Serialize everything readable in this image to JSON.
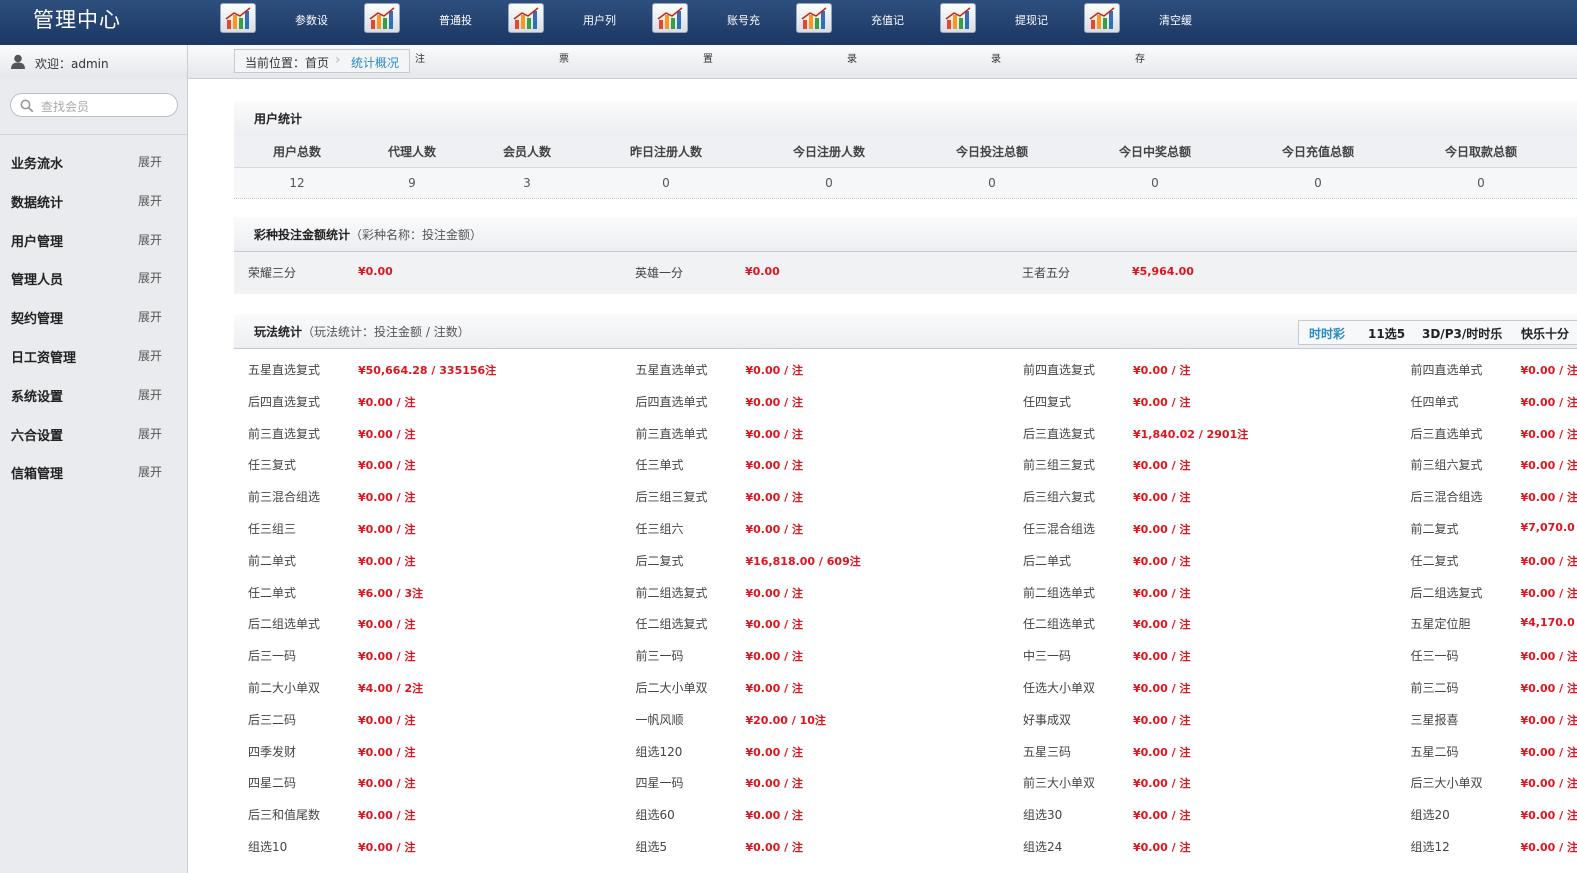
{
  "header": {
    "title": "管理中心",
    "nav": [
      "参数设",
      "普通投",
      "用户列",
      "账号充",
      "充值记",
      "提现记",
      "清空缓"
    ],
    "ghost_marks": [
      "注",
      "票",
      "置",
      "录",
      "录",
      "存"
    ]
  },
  "welcome": {
    "label": "欢迎：admin"
  },
  "breadcrumb": {
    "prefix": "当前位置：首页",
    "current": "统计概况"
  },
  "search": {
    "placeholder": "查找会员"
  },
  "sidebar": {
    "items": [
      {
        "label": "业务流水",
        "toggle": "展开"
      },
      {
        "label": "数据统计",
        "toggle": "展开"
      },
      {
        "label": "用户管理",
        "toggle": "展开"
      },
      {
        "label": "管理人员",
        "toggle": "展开"
      },
      {
        "label": "契约管理",
        "toggle": "展开"
      },
      {
        "label": "日工资管理",
        "toggle": "展开"
      },
      {
        "label": "系统设置",
        "toggle": "展开"
      },
      {
        "label": "六合设置",
        "toggle": "展开"
      },
      {
        "label": "信箱管理",
        "toggle": "展开"
      }
    ]
  },
  "user_stats": {
    "title": "用户统计",
    "headers": [
      "用户总数",
      "代理人数",
      "会员人数",
      "昨日注册人数",
      "今日注册人数",
      "今日投注总额",
      "今日中奖总额",
      "今日充值总额",
      "今日取款总额"
    ],
    "values": [
      "12",
      "9",
      "3",
      "0",
      "0",
      "0",
      "0",
      "0",
      "0"
    ]
  },
  "lottery_stats": {
    "title": "彩种投注金额统计",
    "subtitle": "（彩种名称：投注金额）",
    "items": [
      {
        "name": "荣耀三分",
        "amount": "¥0.00"
      },
      {
        "name": "英雄一分",
        "amount": "¥0.00"
      },
      {
        "name": "王者五分",
        "amount": "¥5,964.00"
      }
    ]
  },
  "play_stats": {
    "title": "玩法统计",
    "subtitle": "（玩法统计：投注金额 / 注数）",
    "tabs": [
      "时时彩",
      "11选5",
      "3D/P3/时时乐",
      "快乐十分"
    ],
    "rows": [
      [
        [
          "五星直选复式",
          "¥50,664.28 / 335156注"
        ],
        [
          "五星直选单式",
          "¥0.00 / 注"
        ],
        [
          "前四直选复式",
          "¥0.00 / 注"
        ],
        [
          "前四直选单式",
          "¥0.00 / 注"
        ]
      ],
      [
        [
          "后四直选复式",
          "¥0.00 / 注"
        ],
        [
          "后四直选单式",
          "¥0.00 / 注"
        ],
        [
          "任四复式",
          "¥0.00 / 注"
        ],
        [
          "任四单式",
          "¥0.00 / 注"
        ]
      ],
      [
        [
          "前三直选复式",
          "¥0.00 / 注"
        ],
        [
          "前三直选单式",
          "¥0.00 / 注"
        ],
        [
          "后三直选复式",
          "¥1,840.02 / 2901注"
        ],
        [
          "后三直选单式",
          "¥0.00 / 注"
        ]
      ],
      [
        [
          "任三复式",
          "¥0.00 / 注"
        ],
        [
          "任三单式",
          "¥0.00 / 注"
        ],
        [
          "前三组三复式",
          "¥0.00 / 注"
        ],
        [
          "前三组六复式",
          "¥0.00 / 注"
        ]
      ],
      [
        [
          "前三混合组选",
          "¥0.00 / 注"
        ],
        [
          "后三组三复式",
          "¥0.00 / 注"
        ],
        [
          "后三组六复式",
          "¥0.00 / 注"
        ],
        [
          "后三混合组选",
          "¥0.00 / 注"
        ]
      ],
      [
        [
          "任三组三",
          "¥0.00 / 注"
        ],
        [
          "任三组六",
          "¥0.00 / 注"
        ],
        [
          "任三混合组选",
          "¥0.00 / 注"
        ],
        [
          "前二复式",
          "¥7,070.0"
        ]
      ],
      [
        [
          "前二单式",
          "¥0.00 / 注"
        ],
        [
          "后二复式",
          "¥16,818.00 / 609注"
        ],
        [
          "后二单式",
          "¥0.00 / 注"
        ],
        [
          "任二复式",
          "¥0.00 / 注"
        ]
      ],
      [
        [
          "任二单式",
          "¥6.00 / 3注"
        ],
        [
          "前二组选复式",
          "¥0.00 / 注"
        ],
        [
          "前二组选单式",
          "¥0.00 / 注"
        ],
        [
          "后二组选复式",
          "¥0.00 / 注"
        ]
      ],
      [
        [
          "后二组选单式",
          "¥0.00 / 注"
        ],
        [
          "任二组选复式",
          "¥0.00 / 注"
        ],
        [
          "任二组选单式",
          "¥0.00 / 注"
        ],
        [
          "五星定位胆",
          "¥4,170.0"
        ]
      ],
      [
        [
          "后三一码",
          "¥0.00 / 注"
        ],
        [
          "前三一码",
          "¥0.00 / 注"
        ],
        [
          "中三一码",
          "¥0.00 / 注"
        ],
        [
          "任三一码",
          "¥0.00 / 注"
        ]
      ],
      [
        [
          "前二大小单双",
          "¥4.00 / 2注"
        ],
        [
          "后二大小单双",
          "¥0.00 / 注"
        ],
        [
          "任选大小单双",
          "¥0.00 / 注"
        ],
        [
          "前三二码",
          "¥0.00 / 注"
        ]
      ],
      [
        [
          "后三二码",
          "¥0.00 / 注"
        ],
        [
          "一帆风顺",
          "¥20.00 / 10注"
        ],
        [
          "好事成双",
          "¥0.00 / 注"
        ],
        [
          "三星报喜",
          "¥0.00 / 注"
        ]
      ],
      [
        [
          "四季发财",
          "¥0.00 / 注"
        ],
        [
          "组选120",
          "¥0.00 / 注"
        ],
        [
          "五星三码",
          "¥0.00 / 注"
        ],
        [
          "五星二码",
          "¥0.00 / 注"
        ]
      ],
      [
        [
          "四星二码",
          "¥0.00 / 注"
        ],
        [
          "四星一码",
          "¥0.00 / 注"
        ],
        [
          "前三大小单双",
          "¥0.00 / 注"
        ],
        [
          "后三大小单双",
          "¥0.00 / 注"
        ]
      ],
      [
        [
          "后三和值尾数",
          "¥0.00 / 注"
        ],
        [
          "组选60",
          "¥0.00 / 注"
        ],
        [
          "组选30",
          "¥0.00 / 注"
        ],
        [
          "组选20",
          "¥0.00 / 注"
        ]
      ],
      [
        [
          "组选10",
          "¥0.00 / 注"
        ],
        [
          "组选5",
          "¥0.00 / 注"
        ],
        [
          "组选24",
          "¥0.00 / 注"
        ],
        [
          "组选12",
          "¥0.00 / 注"
        ]
      ]
    ]
  },
  "colors": {
    "header": "#1c3763",
    "accent": "#2a89c6",
    "money": "#e0141e"
  }
}
